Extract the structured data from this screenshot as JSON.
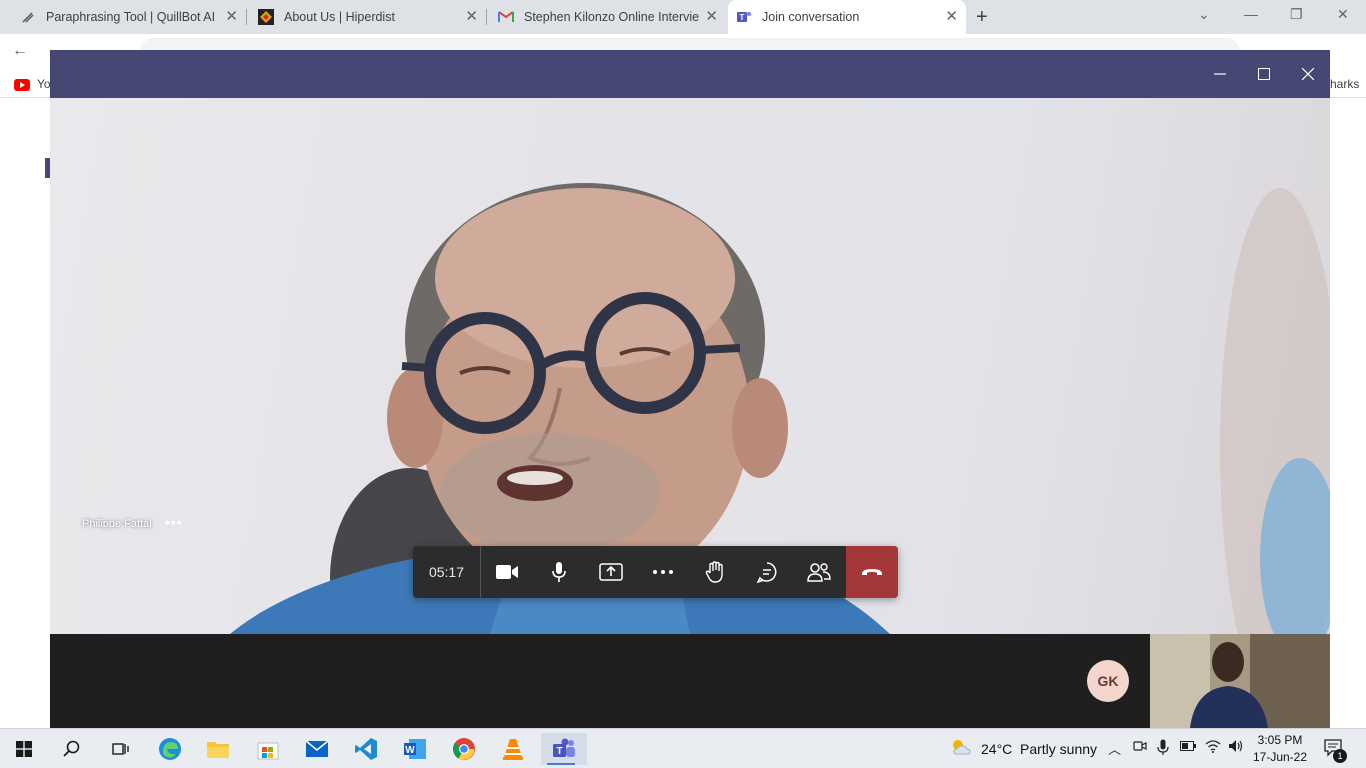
{
  "browser": {
    "tabs": [
      {
        "title": "Paraphrasing Tool | QuillBot AI",
        "icon": "quillbot-icon"
      },
      {
        "title": "About Us | Hiperdist",
        "icon": "hiperdist-icon"
      },
      {
        "title": "Stephen Kilonzo Online Interview",
        "icon": "gmail-icon"
      },
      {
        "title": "Join conversation",
        "icon": "teams-icon",
        "active": true
      }
    ],
    "new_tab": "+",
    "bookmark_left": "Yo",
    "bookmark_right": "harks"
  },
  "call": {
    "participant_name": "Philippe Fattal",
    "participant_more": "•••",
    "timer": "05:17",
    "self_initials": "GK",
    "accent_color": "#464775",
    "hangup_color": "#a4373a"
  },
  "taskbar": {
    "weather_temp": "24°C",
    "weather_desc": "Partly sunny",
    "time": "3:05 PM",
    "date": "17-Jun-22",
    "notification_count": "1"
  }
}
